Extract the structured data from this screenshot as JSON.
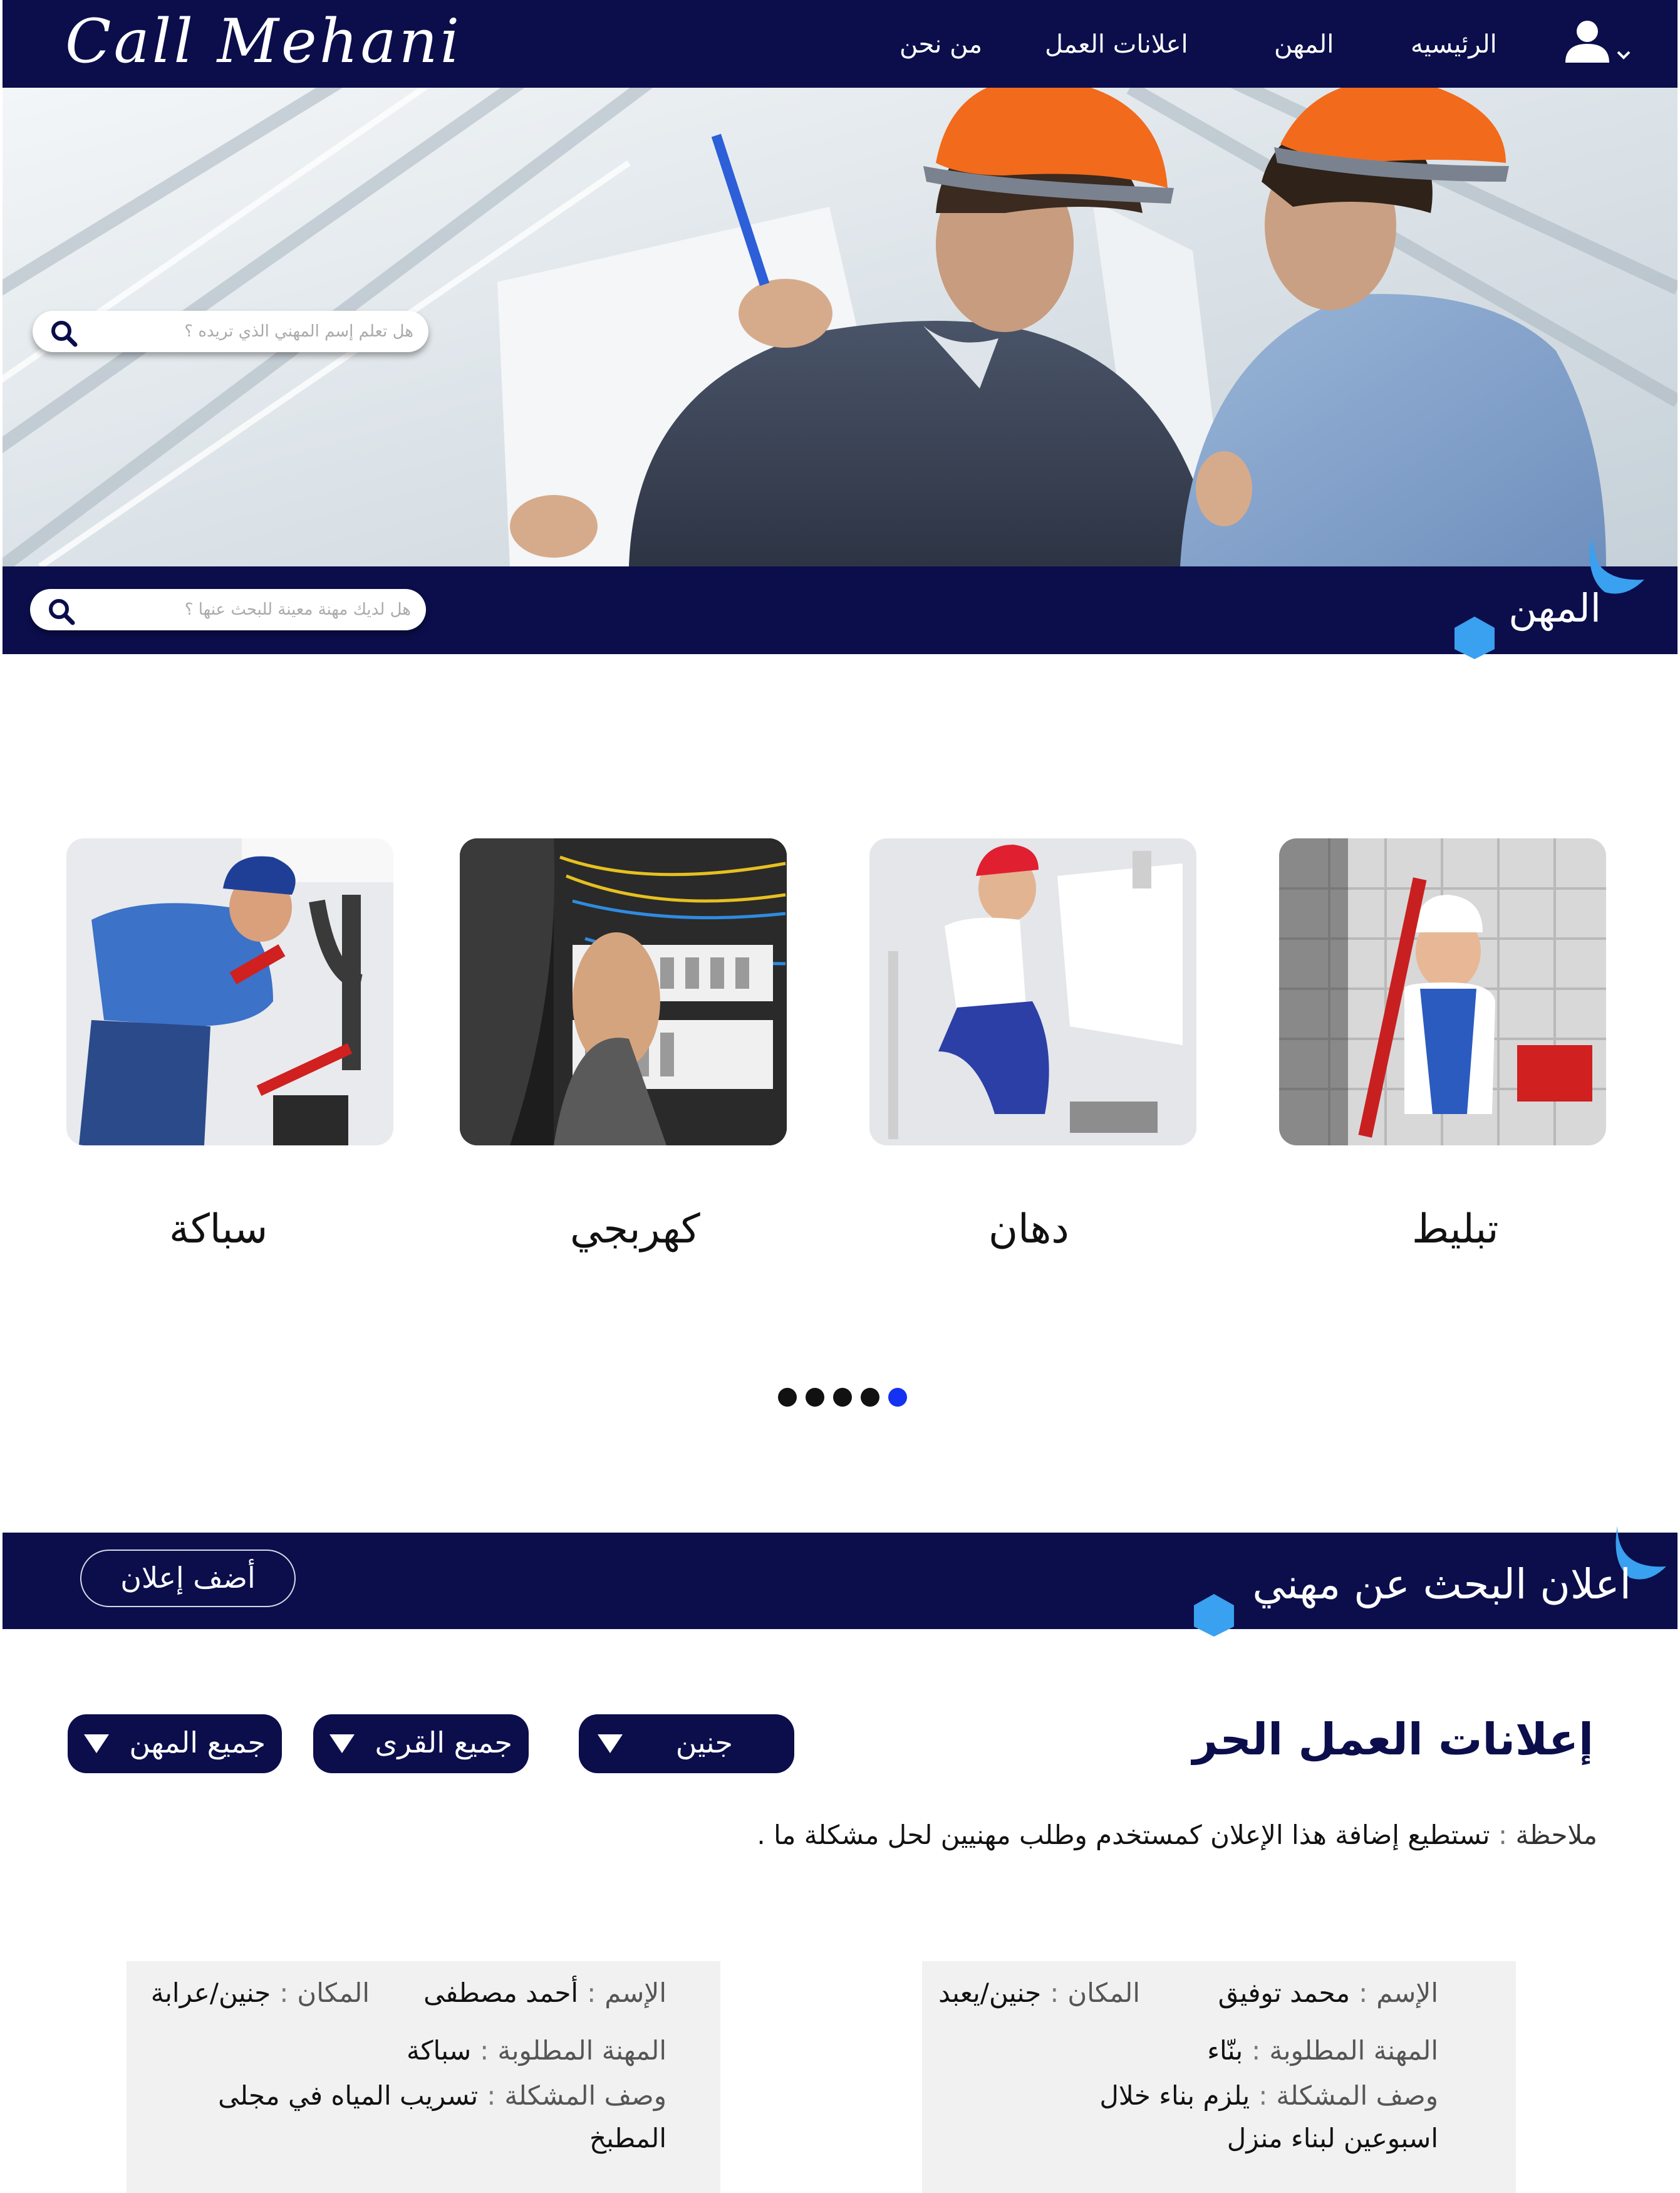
{
  "brand": "Call Mehani",
  "nav": {
    "home": "الرئيسيه",
    "professions": "المهن",
    "job_ads": "اعلانات العمل",
    "about": "من نحن",
    "user_icon": "user-icon",
    "chevron_icon": "chevron-down-icon"
  },
  "hero": {
    "search_placeholder": "هل تعلم إسم المهني الذي تريده ؟",
    "search_icon": "search-icon"
  },
  "professions_section": {
    "title": "المهن",
    "search_placeholder": "هل لديك مهنة معينة للبحث عنها ؟",
    "items": [
      {
        "label": "تبليط",
        "image": "tiler-photo"
      },
      {
        "label": "دهان",
        "image": "painter-photo"
      },
      {
        "label": "كهربجي",
        "image": "electrician-photo"
      },
      {
        "label": "سباكة",
        "image": "plumber-photo"
      }
    ],
    "carousel": {
      "total": 5,
      "active_index": 4
    }
  },
  "ads_section": {
    "title": "اعلان البحث عن مهني",
    "add_button": "أضف إعلان",
    "heading": "إعلانات العمل الحر",
    "filters": {
      "city": "جنين",
      "villages": "جميع القرى",
      "professions": "جميع المهن"
    },
    "note_key": "ملاحظة",
    "note_text": "تستطيع إضافة هذا الإعلان كمستخدم وطلب مهنيين لحل مشكلة ما .",
    "labels": {
      "name": "الإسم",
      "place": "المكان",
      "profession": "المهنة المطلوبة",
      "description": "وصف المشكلة"
    },
    "cards": [
      {
        "name": "محمد توفيق",
        "place": "جنين/يعبد",
        "profession": "بنّاء",
        "description_line1": "يلزم بناء خلال",
        "description_line2": "اسبوعين لبناء منزل"
      },
      {
        "name": "أحمد مصطفى",
        "place": "جنين/عرابة",
        "profession": "سباكة",
        "description_line1": "تسريب المياه في مجلى",
        "description_line2": "المطبخ"
      }
    ]
  },
  "colors": {
    "navy": "#0b0e4b",
    "accent_blue": "#3aa0f0",
    "active_dot": "#1531f2",
    "card_bg": "#f1f1f1"
  }
}
